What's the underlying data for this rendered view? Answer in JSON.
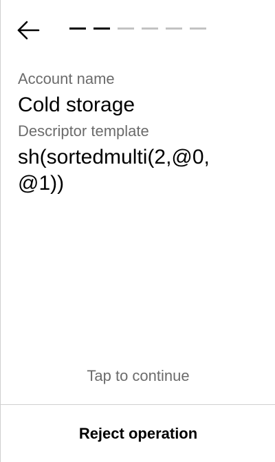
{
  "header": {
    "back_icon": "arrow-left-icon",
    "progress": {
      "total_steps": 6,
      "completed_steps": 2,
      "active_color": "#000000",
      "inactive_color": "#c2c2c2"
    }
  },
  "fields": [
    {
      "label": "Account name",
      "value": "Cold storage"
    },
    {
      "label": "Descriptor template",
      "value": "sh(sortedmulti(2,@0,@1))"
    }
  ],
  "hint": "Tap to continue",
  "footer": {
    "reject_label": "Reject operation"
  }
}
